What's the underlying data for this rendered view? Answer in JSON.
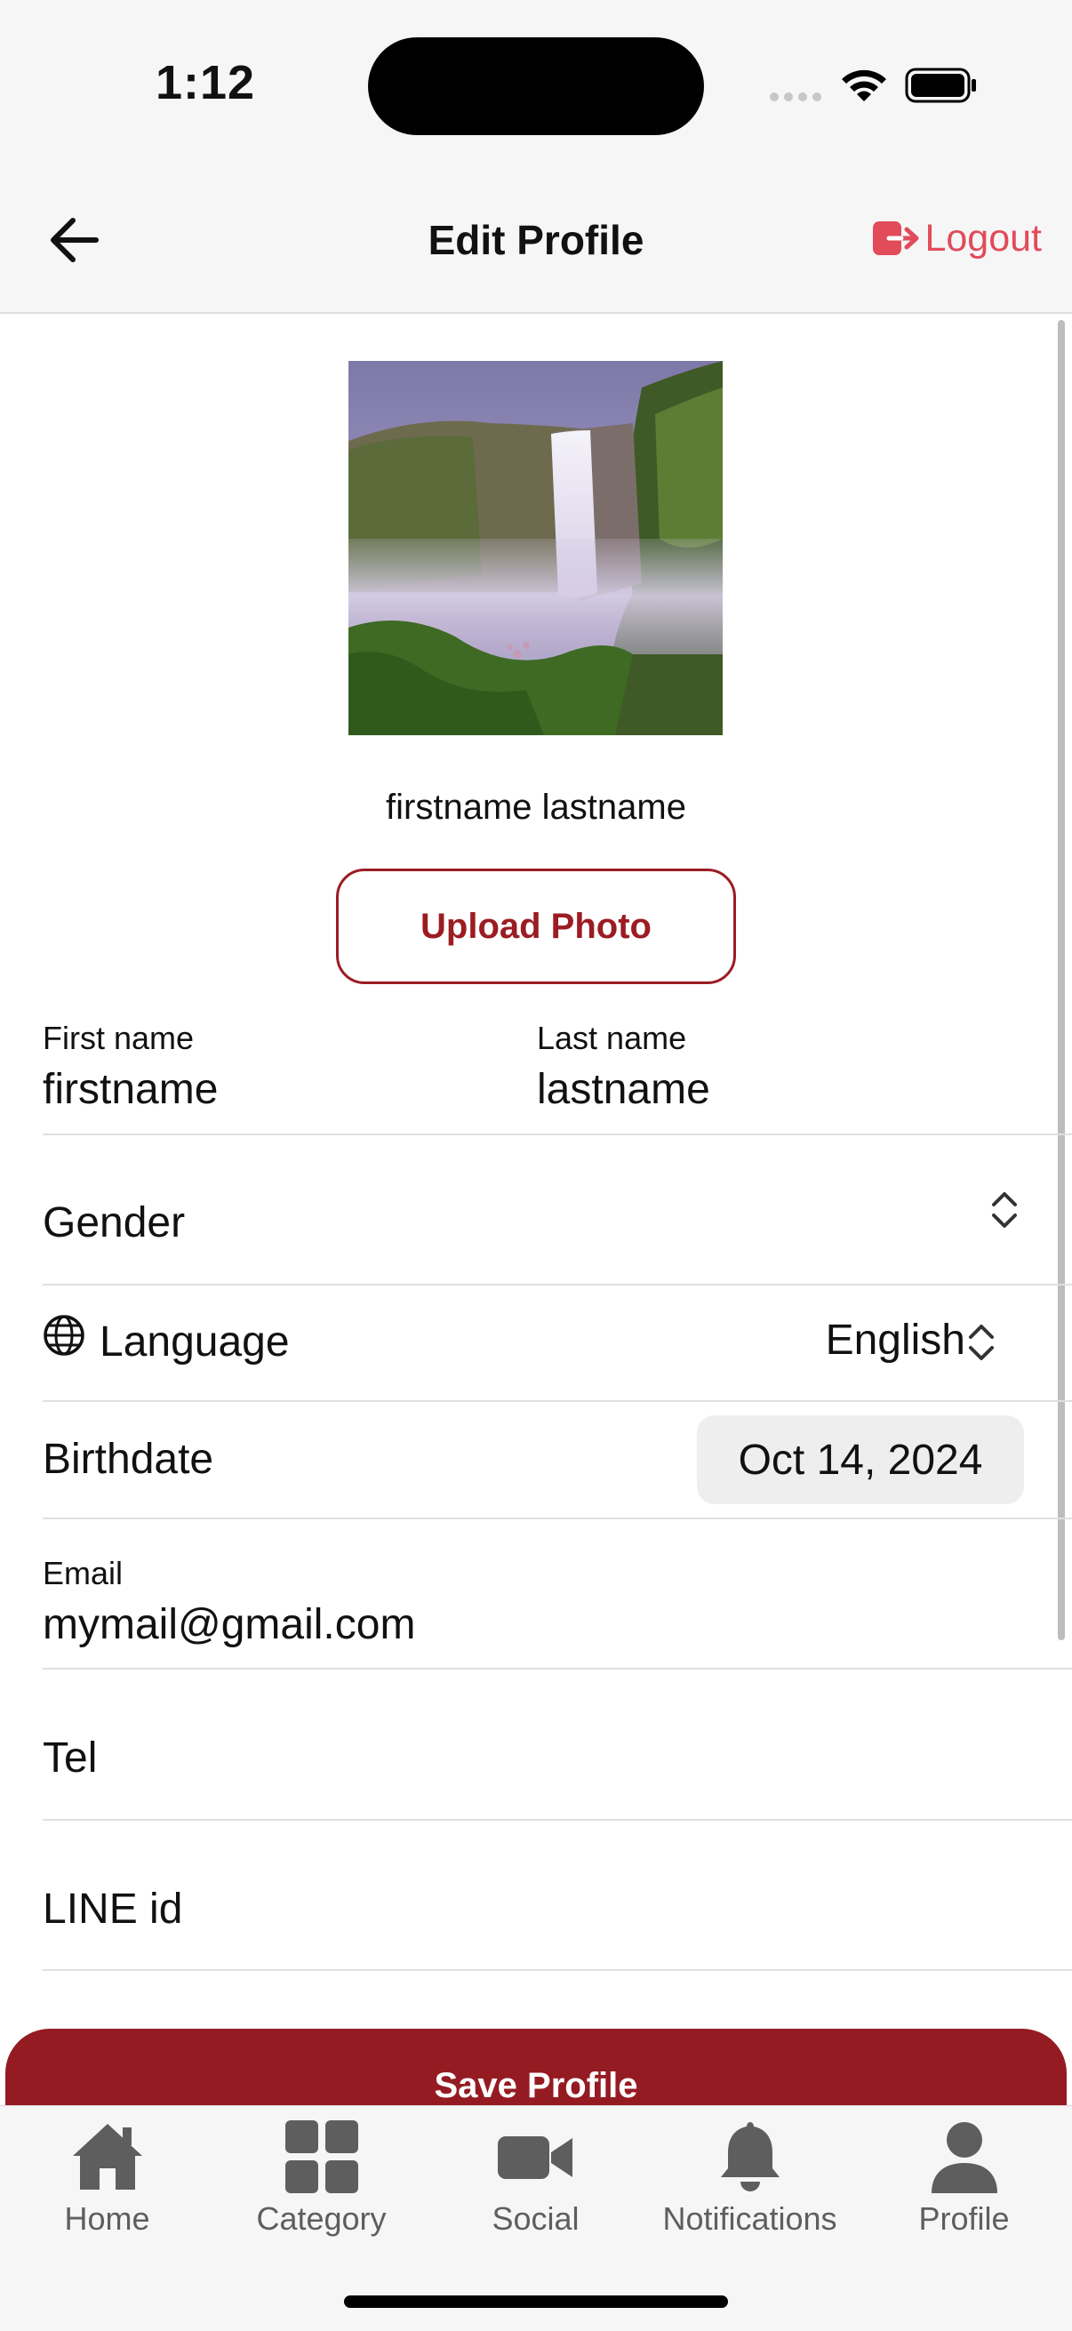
{
  "status_bar": {
    "time": "1:12"
  },
  "header": {
    "title": "Edit Profile",
    "logout_label": "Logout"
  },
  "profile": {
    "full_name": "firstname lastname",
    "upload_label": "Upload Photo"
  },
  "form": {
    "first_name": {
      "label": "First name",
      "value": "firstname"
    },
    "last_name": {
      "label": "Last name",
      "value": "lastname"
    },
    "gender": {
      "label": "Gender",
      "value": ""
    },
    "language": {
      "label": "Language",
      "value": "English"
    },
    "birthdate": {
      "label": "Birthdate",
      "value": "Oct 14, 2024"
    },
    "email": {
      "label": "Email",
      "value": "mymail@gmail.com"
    },
    "tel": {
      "label": "Tel",
      "value": ""
    },
    "line_id": {
      "label": "LINE id",
      "value": ""
    }
  },
  "save_label": "Save Profile",
  "tabs": [
    {
      "label": "Home",
      "icon": "home-icon"
    },
    {
      "label": "Category",
      "icon": "grid-icon"
    },
    {
      "label": "Social",
      "icon": "video-camera-icon"
    },
    {
      "label": "Notifications",
      "icon": "bell-icon"
    },
    {
      "label": "Profile",
      "icon": "person-icon"
    }
  ],
  "colors": {
    "accent": "#951b22",
    "logout": "#e14b5a",
    "tab_inactive": "#5e5e5e",
    "bar_background": "#f6f6f6"
  }
}
